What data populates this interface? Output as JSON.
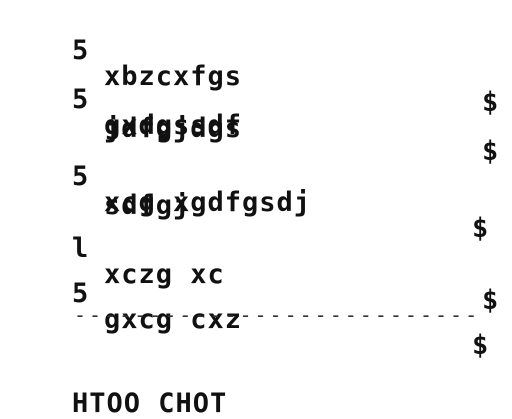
{
  "receipt": {
    "items": [
      {
        "qty": "5",
        "name": "xbzcxfgs",
        "price": "$"
      },
      {
        "qty": "5",
        "name": "gxdgssdf",
        "name2": "jdfgjdgs",
        "price": "$"
      },
      {
        "qty": "5",
        "name": "xcg xgdfgsdj",
        "name2": "sdfgj",
        "price": "$"
      },
      {
        "qty": "l",
        "name": "xczg xc",
        "price": "$"
      },
      {
        "qty": "5",
        "name": "gxcg cxz",
        "price": "$"
      }
    ],
    "separator": "---------------------------",
    "footer": "HTOO CHOT"
  }
}
